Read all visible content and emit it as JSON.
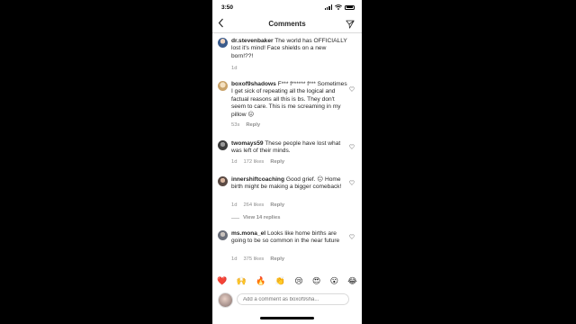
{
  "status_bar": {
    "time": "3:50",
    "icons": [
      "location-arrow-icon",
      "signal-icon",
      "wifi-icon",
      "battery-icon"
    ]
  },
  "header": {
    "title": "Comments",
    "back_icon": "chevron-left-icon",
    "filter_icon": "send-icon"
  },
  "comments": [
    {
      "username": "dr.stevenbaker",
      "text": "The world has OFFICIALLY lost it's mind! Face shields on a new born!??!",
      "time": "1d",
      "likes": "",
      "reply_label": "",
      "avatar_color": "#3a5b8c"
    },
    {
      "username": "boxof9shadows",
      "text": "F*** f****** f*** Sometimes I get sick of repeating all the logical and factual reasons all this is bs. They don't seem to care. This is me screaming in my pillow 😖",
      "time": "53s",
      "likes": "",
      "reply_label": "Reply",
      "avatar_color": "#c9a36a"
    },
    {
      "username": "twomays59",
      "text": "These people have lost what was left of their minds.",
      "time": "1d",
      "likes": "172 likes",
      "reply_label": "Reply",
      "avatar_color": "#4a4a4a"
    },
    {
      "username": "innershiftcoaching",
      "text": "Good grief. 😑 Home birth might be making a bigger comeback!",
      "time": "1d",
      "likes": "264 likes",
      "reply_label": "Reply",
      "avatar_color": "#5a4a44"
    },
    {
      "username": "ms.mona_el",
      "text": "Looks like home births are going to be so common in the near future",
      "time": "1d",
      "likes": "375 likes",
      "reply_label": "Reply",
      "avatar_color": "#6b6f7a"
    }
  ],
  "view_replies": "View 14 replies",
  "emoji_bar": [
    "❤️",
    "🙌",
    "🔥",
    "👏",
    "😢",
    "😍",
    "😮",
    "😂"
  ],
  "comment_input": {
    "placeholder": "Add a comment as boxof9sha..."
  }
}
